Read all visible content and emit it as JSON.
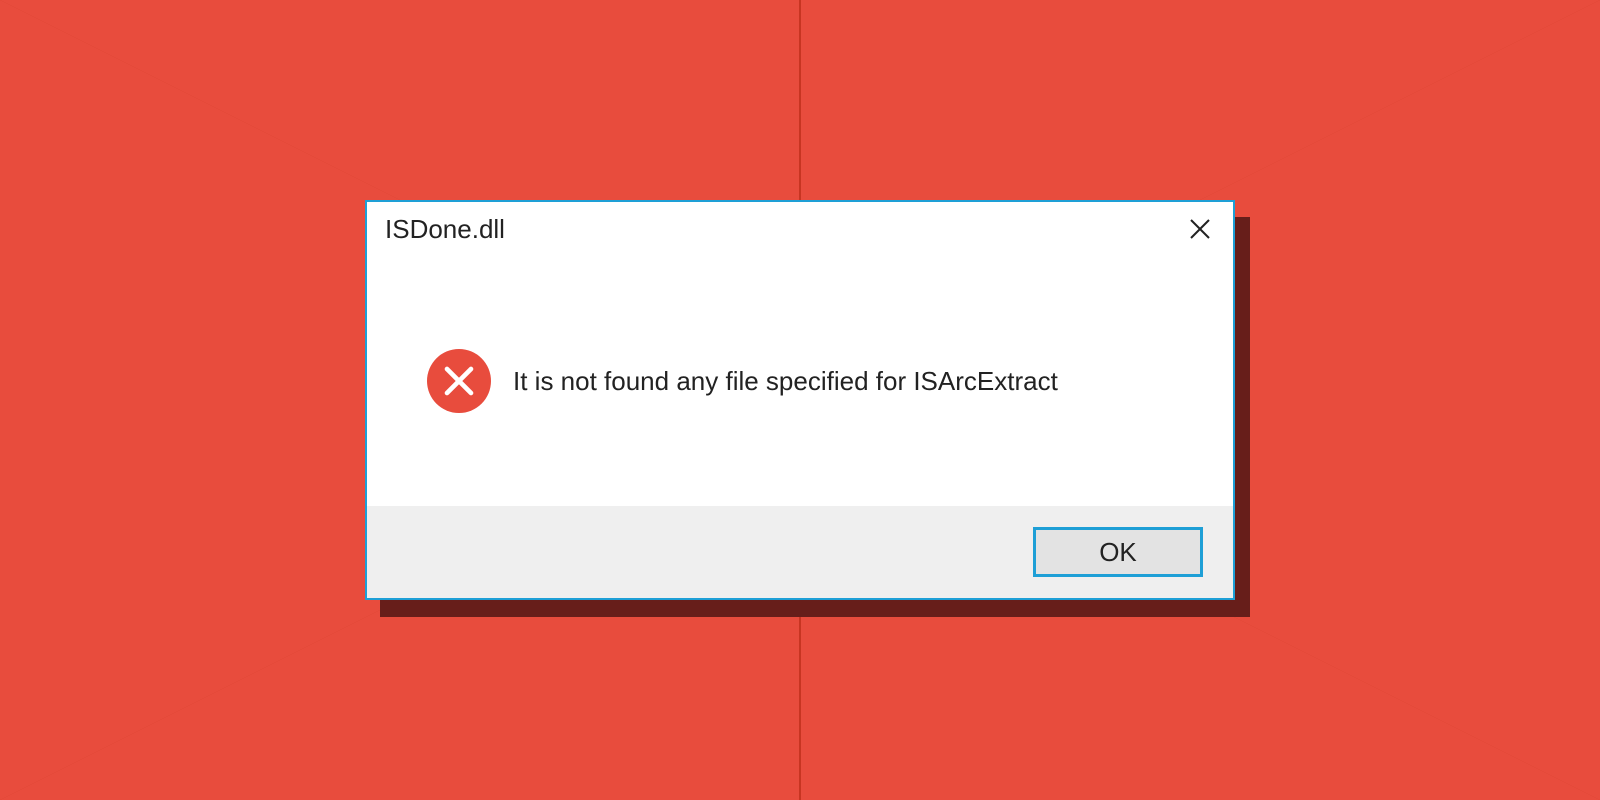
{
  "dialog": {
    "title": "ISDone.dll",
    "message": "It is not found any file specified for ISArcExtract",
    "ok_label": "OK"
  },
  "colors": {
    "bg_dark": "#c73522",
    "bg_light": "#e84c3d",
    "accent": "#1e9fd6"
  }
}
